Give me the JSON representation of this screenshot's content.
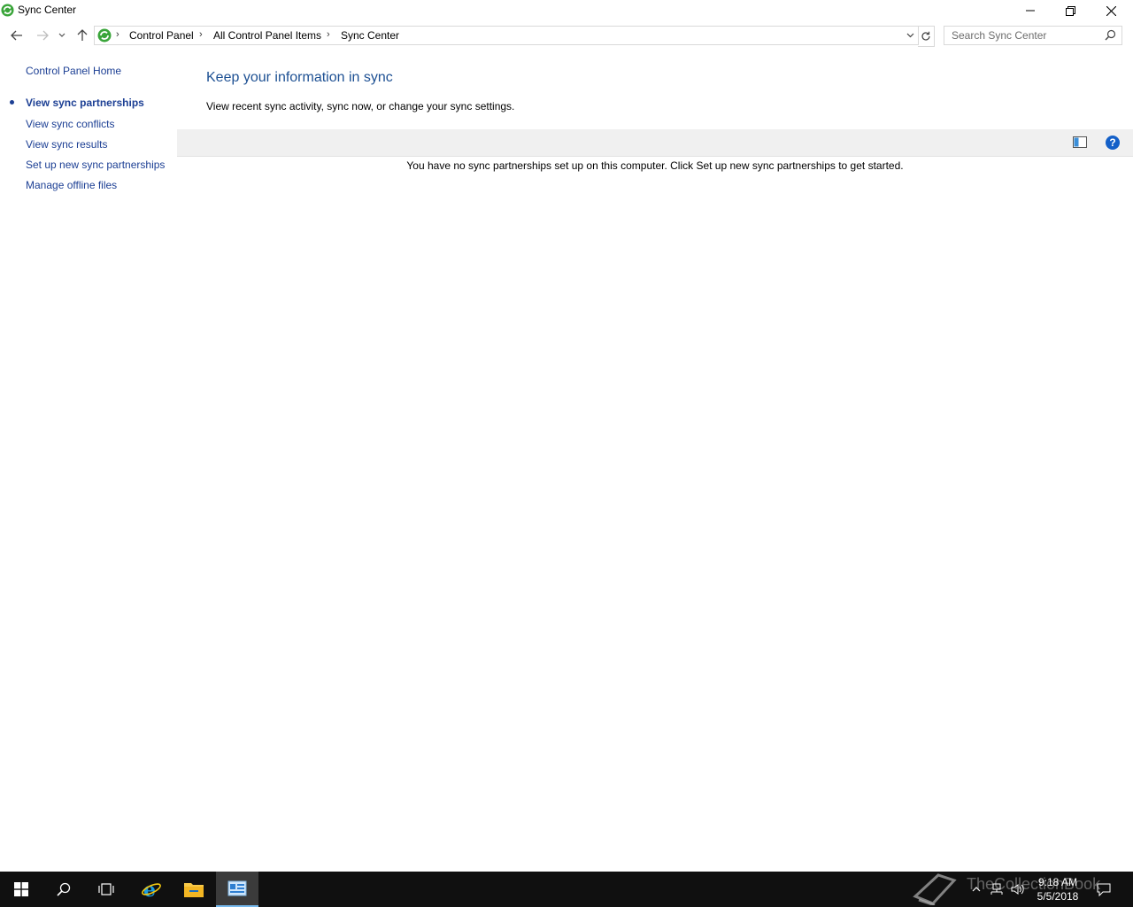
{
  "window": {
    "title": "Sync Center"
  },
  "address": {
    "crumbs": [
      "Control Panel",
      "All Control Panel Items",
      "Sync Center"
    ],
    "search_placeholder": "Search Sync Center"
  },
  "sidebar": {
    "home": "Control Panel Home",
    "items": [
      {
        "label": "View sync partnerships",
        "active": true
      },
      {
        "label": "View sync conflicts"
      },
      {
        "label": "View sync results"
      },
      {
        "label": "Set up new sync partnerships"
      },
      {
        "label": "Manage offline files"
      }
    ]
  },
  "main": {
    "heading": "Keep your information in sync",
    "subtext": "View recent sync activity, sync now, or change your sync settings.",
    "empty_message": "You have no sync partnerships set up on this computer. Click Set up new sync partnerships to get started."
  },
  "taskbar": {
    "watermark": "TheCollectionBook",
    "time": "9:18 AM",
    "date": "5/5/2018"
  },
  "colors": {
    "link": "#1c3f94",
    "heading": "#1d5093",
    "taskbar": "#101010",
    "accent": "#76b9ed"
  }
}
